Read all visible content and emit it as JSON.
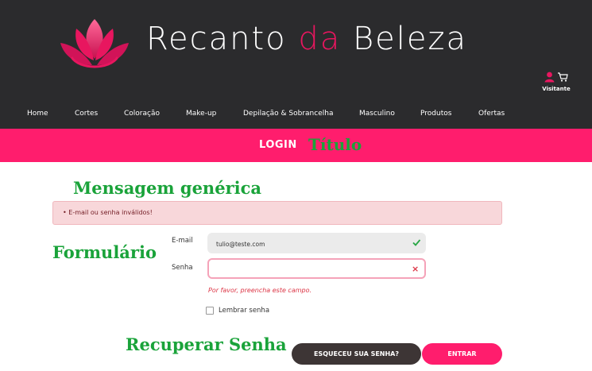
{
  "header": {
    "brand_part1": "Recanto ",
    "brand_part2": "da",
    "brand_part3": " Beleza",
    "user_label": "Visitante",
    "icons": [
      "user-icon",
      "cart-icon",
      "lotus-logo-icon"
    ],
    "colors": {
      "background": "#2b2b2d",
      "accent": "#e8165f",
      "text": "#ffffff"
    }
  },
  "nav": {
    "items": [
      {
        "label": "Home"
      },
      {
        "label": "Cortes"
      },
      {
        "label": "Coloração"
      },
      {
        "label": "Make-up"
      },
      {
        "label": "Depilação & Sobrancelha"
      },
      {
        "label": "Masculino"
      },
      {
        "label": "Produtos"
      },
      {
        "label": "Ofertas"
      }
    ]
  },
  "page": {
    "title": "LOGIN",
    "title_band_color": "#ff1d6d"
  },
  "annotations": {
    "title": "Título",
    "message": "Mensagem genérica",
    "form": "Formulário",
    "recover": "Recuperar Senha"
  },
  "alert": {
    "text": "• E-mail ou senha inválidos!"
  },
  "form": {
    "email_label": "E-mail",
    "email_value": "tulio@teste.com",
    "password_label": "Senha",
    "password_value": "",
    "password_error": "Por favor, preencha este campo.",
    "remember_label": "Lembrar senha",
    "remember_checked": false
  },
  "buttons": {
    "forgot": "ESQUECEU SUA SENHA?",
    "enter": "ENTRAR"
  }
}
